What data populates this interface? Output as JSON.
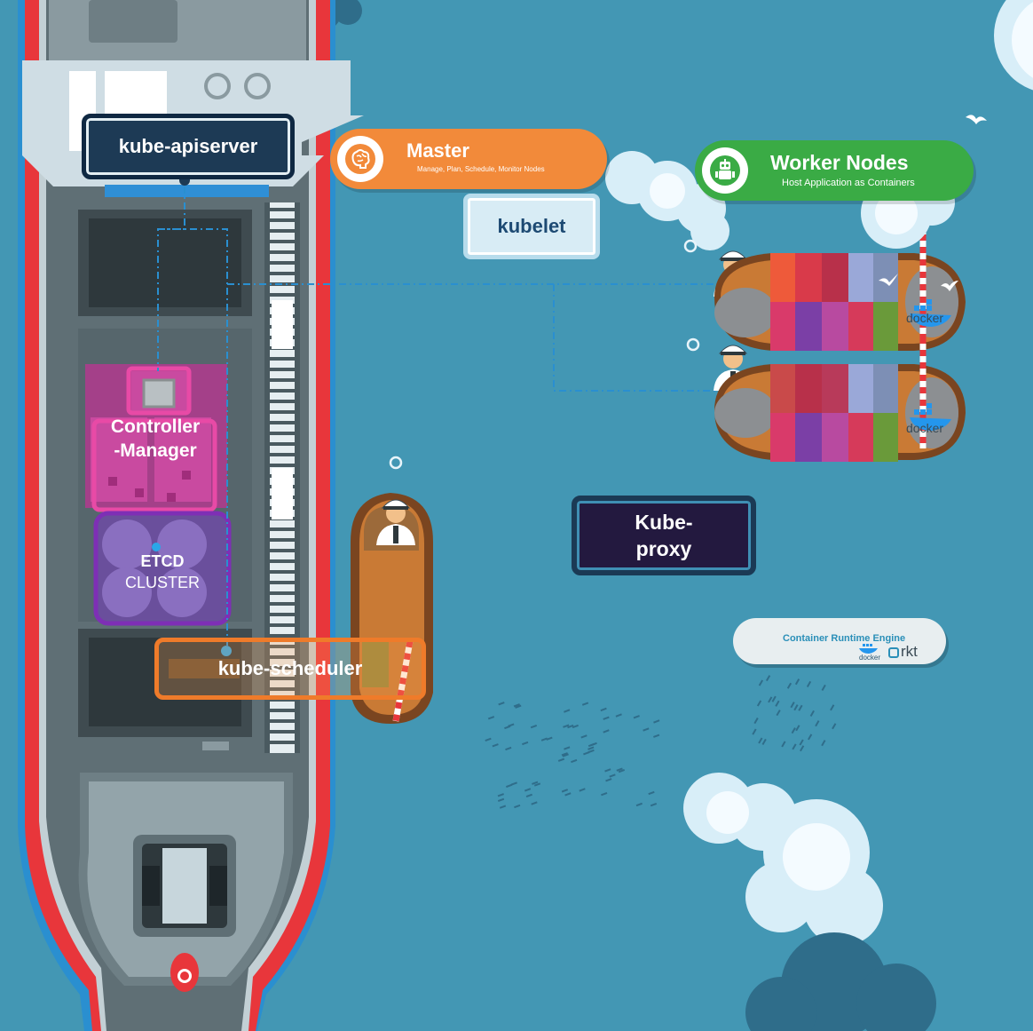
{
  "components": {
    "apiserver": "kube-apiserver",
    "controller_manager": [
      "Controller",
      "-Manager"
    ],
    "etcd": [
      "ETCD",
      "CLUSTER"
    ],
    "scheduler": "kube-scheduler",
    "kubelet": "kubelet",
    "kube_proxy": [
      "Kube-",
      "proxy"
    ]
  },
  "master": {
    "title": "Master",
    "subtitle": "Manage, Plan, Schedule, Monitor Nodes"
  },
  "worker": {
    "title": "Worker Nodes",
    "subtitle": "Host Application  as Containers"
  },
  "runtime": {
    "title": "Container Runtime Engine",
    "docker": "docker",
    "rkt": "rkt"
  },
  "docker_labels": [
    "docker",
    "docker"
  ],
  "colors": {
    "sea": "#4397b4",
    "ship_hull": "#e8363b",
    "deck": "#5a6a70",
    "master": "#f28a3a",
    "worker": "#3aab45",
    "controller": "#d63a98",
    "etcd": "#7b3fa6",
    "scheduler": "#ef7b2a",
    "apiserver": "#1d4a73",
    "kubelet_bg": "#d8ecf5",
    "kube_proxy_bg": "#23193f"
  },
  "icons": {
    "master": "brain-icon",
    "worker": "robot-icon"
  }
}
